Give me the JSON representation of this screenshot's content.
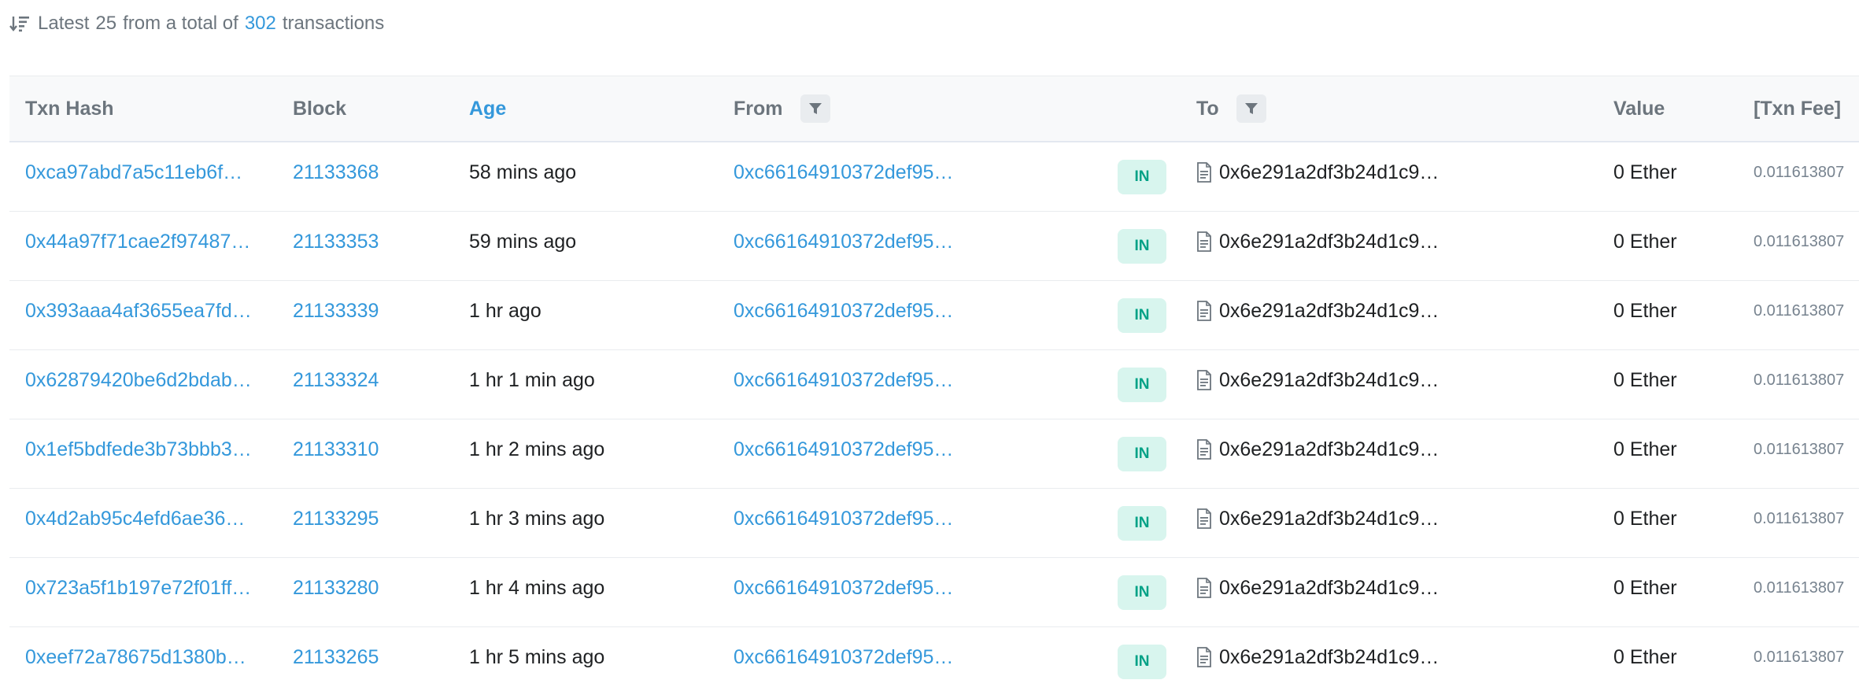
{
  "summary": {
    "prefix": "Latest",
    "count": "25",
    "middle": "from a total of",
    "total": "302",
    "suffix": "transactions",
    "icon": "sort-descending-icon"
  },
  "columns": {
    "txn_hash": "Txn Hash",
    "block": "Block",
    "age": "Age",
    "from": "From",
    "to": "To",
    "value": "Value",
    "txn_fee": "[Txn Fee]"
  },
  "colors": {
    "link": "#3498db",
    "in_badge_bg": "#d8f5ee",
    "in_badge_text": "#00a186",
    "header_bg": "#f8f9fa"
  },
  "rows": [
    {
      "hash": "0xca97abd7a5c11eb6f…",
      "block": "21133368",
      "age": "58 mins ago",
      "from": "0xc66164910372def95…",
      "direction": "IN",
      "to": "0x6e291a2df3b24d1c9…",
      "value": "0 Ether",
      "fee": "0.011613807"
    },
    {
      "hash": "0x44a97f71cae2f97487…",
      "block": "21133353",
      "age": "59 mins ago",
      "from": "0xc66164910372def95…",
      "direction": "IN",
      "to": "0x6e291a2df3b24d1c9…",
      "value": "0 Ether",
      "fee": "0.011613807"
    },
    {
      "hash": "0x393aaa4af3655ea7fd…",
      "block": "21133339",
      "age": "1 hr ago",
      "from": "0xc66164910372def95…",
      "direction": "IN",
      "to": "0x6e291a2df3b24d1c9…",
      "value": "0 Ether",
      "fee": "0.011613807"
    },
    {
      "hash": "0x62879420be6d2bdab…",
      "block": "21133324",
      "age": "1 hr 1 min ago",
      "from": "0xc66164910372def95…",
      "direction": "IN",
      "to": "0x6e291a2df3b24d1c9…",
      "value": "0 Ether",
      "fee": "0.011613807"
    },
    {
      "hash": "0x1ef5bdfede3b73bbb3…",
      "block": "21133310",
      "age": "1 hr 2 mins ago",
      "from": "0xc66164910372def95…",
      "direction": "IN",
      "to": "0x6e291a2df3b24d1c9…",
      "value": "0 Ether",
      "fee": "0.011613807"
    },
    {
      "hash": "0x4d2ab95c4efd6ae36…",
      "block": "21133295",
      "age": "1 hr 3 mins ago",
      "from": "0xc66164910372def95…",
      "direction": "IN",
      "to": "0x6e291a2df3b24d1c9…",
      "value": "0 Ether",
      "fee": "0.011613807"
    },
    {
      "hash": "0x723a5f1b197e72f01ff…",
      "block": "21133280",
      "age": "1 hr 4 mins ago",
      "from": "0xc66164910372def95…",
      "direction": "IN",
      "to": "0x6e291a2df3b24d1c9…",
      "value": "0 Ether",
      "fee": "0.011613807"
    },
    {
      "hash": "0xeef72a78675d1380b…",
      "block": "21133265",
      "age": "1 hr 5 mins ago",
      "from": "0xc66164910372def95…",
      "direction": "IN",
      "to": "0x6e291a2df3b24d1c9…",
      "value": "0 Ether",
      "fee": "0.011613807"
    }
  ]
}
